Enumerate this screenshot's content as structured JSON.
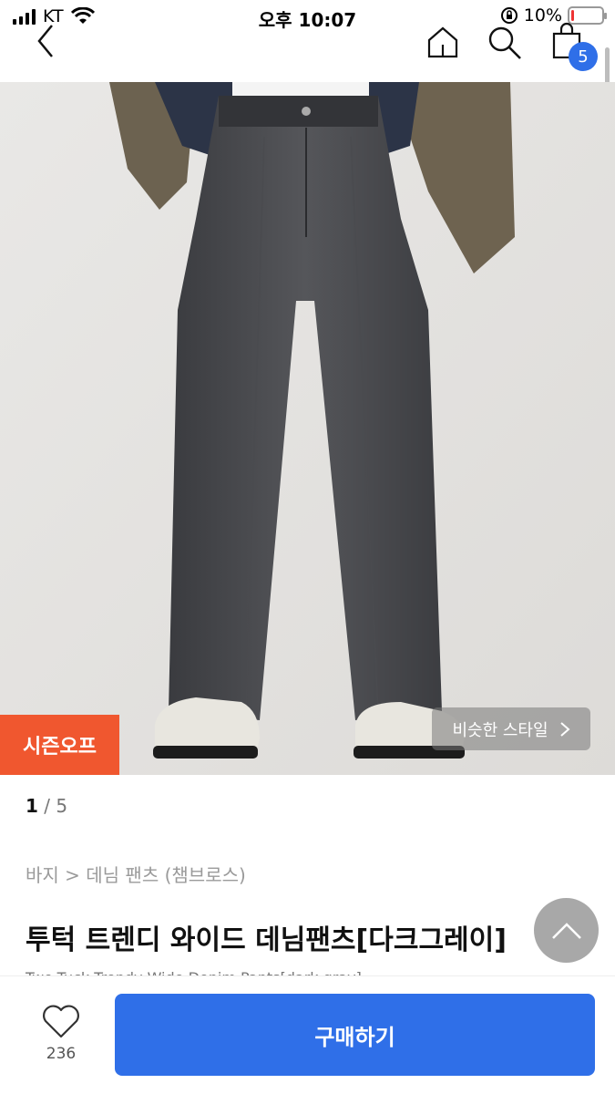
{
  "status_bar": {
    "carrier": "KT",
    "time": "오후 10:07",
    "battery": "10%",
    "battery_level": 0.1
  },
  "nav": {
    "back_icon": "chevron-left-icon",
    "home_icon": "home-icon",
    "search_icon": "search-icon",
    "cart_icon": "shopping-bag-icon",
    "cart_count": "5"
  },
  "product": {
    "season_tag": "시즌오프",
    "similar_style": "비슷한 스타일",
    "image_index": "1",
    "image_total": "/ 5",
    "breadcrumb": "바지 > 데님 팬츠 (챔브로스)",
    "title": "투턱 트렌디 와이드 데님팬츠[다크그레이]",
    "subtitle": "Two-Tuck Trendy Wide Denim Pants[dark gray]"
  },
  "actions": {
    "like_count": "236",
    "buy_label": "구매하기"
  },
  "colors": {
    "accent_blue": "#2f6fe8",
    "season_orange": "#f0572f"
  }
}
